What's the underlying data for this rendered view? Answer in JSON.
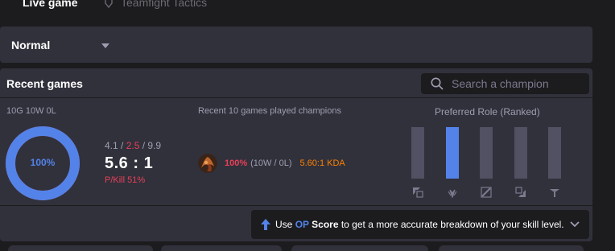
{
  "tabs": {
    "live": "Live game",
    "tft": "Teamfight Tactics"
  },
  "queue": {
    "selected": "Normal"
  },
  "recent": {
    "title": "Recent games",
    "search_placeholder": "Search a champion",
    "record": "10G 10W 0L",
    "winrate": "100%",
    "winrate_value": 1.0,
    "kda": {
      "kills": "4.1",
      "deaths": "2.5",
      "assists": "9.9",
      "sep": " / "
    },
    "ratio": "5.6 : 1",
    "pkill": "P/Kill 51%",
    "champions_title": "Recent 10 games played champions",
    "champions": [
      {
        "winrate": "100%",
        "record": "(10W / 0L)",
        "kda": "5.60:1 KDA"
      }
    ],
    "role_title": "Preferred Role (Ranked)",
    "roles": [
      {
        "name": "top-lane-icon",
        "value": 0
      },
      {
        "name": "jungle-icon",
        "value": 1
      },
      {
        "name": "mid-lane-icon",
        "value": 0
      },
      {
        "name": "bottom-lane-icon",
        "value": 0
      },
      {
        "name": "support-icon",
        "value": 0
      }
    ]
  },
  "banner": {
    "prefix": "Use ",
    "op": "OP",
    "score": " Score",
    "suffix": " to get a more accurate breakdown of your skill level."
  },
  "colors": {
    "accent": "#5383e8",
    "loss": "#e84057",
    "kda": "#ff8200",
    "panel": "#31313c",
    "bg": "#1c1c1f"
  }
}
